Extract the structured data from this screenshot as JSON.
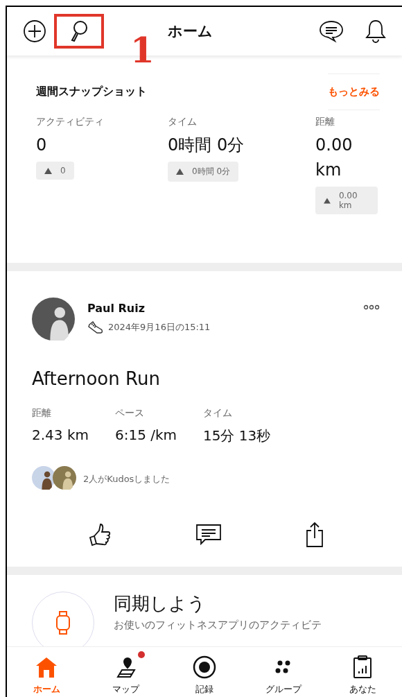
{
  "header": {
    "title": "ホーム",
    "annotation": "1"
  },
  "weekly_snapshot": {
    "title": "週間スナップショット",
    "more_link": "もっとみる",
    "stats": [
      {
        "label": "アクティビティ",
        "value": "0",
        "delta": "0"
      },
      {
        "label": "タイム",
        "value": "0時間 0分",
        "delta": "0時間 0分"
      },
      {
        "label": "距離",
        "value": "0.00 km",
        "delta": "0.00 km"
      }
    ]
  },
  "activity": {
    "athlete": "Paul Ruiz",
    "date": "2024年9月16日の15:11",
    "title": "Afternoon Run",
    "stats": [
      {
        "label": "距離",
        "value": "2.43 km"
      },
      {
        "label": "ペース",
        "value": "6:15 /km"
      },
      {
        "label": "タイム",
        "value": "15分 13秒"
      }
    ],
    "kudos": "2人がKudosしました"
  },
  "sync_card": {
    "title": "同期しよう",
    "text": "お使いのフィットネスアプリのアクティビテ"
  },
  "tab_bar": [
    {
      "label": "ホーム",
      "selected": true,
      "kind": "home",
      "badge": false
    },
    {
      "label": "マップ",
      "selected": false,
      "kind": "map",
      "badge": true
    },
    {
      "label": "記録",
      "selected": false,
      "kind": "record",
      "badge": false
    },
    {
      "label": "グループ",
      "selected": false,
      "kind": "groups",
      "badge": false
    },
    {
      "label": "あなた",
      "selected": false,
      "kind": "you",
      "badge": false
    }
  ]
}
